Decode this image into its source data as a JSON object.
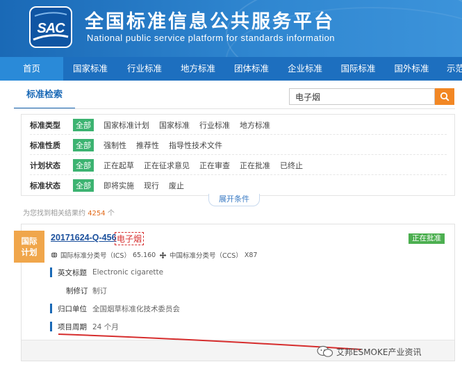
{
  "header": {
    "logo_text": "SAC",
    "title": "全国标准信息公共服务平台",
    "subtitle": "National public service platform  for standards information"
  },
  "nav": {
    "items": [
      {
        "label": "首页"
      },
      {
        "label": "国家标准"
      },
      {
        "label": "行业标准"
      },
      {
        "label": "地方标准"
      },
      {
        "label": "团体标准"
      },
      {
        "label": "企业标准"
      },
      {
        "label": "国际标准"
      },
      {
        "label": "国外标准"
      },
      {
        "label": "示范"
      }
    ]
  },
  "search": {
    "tab_label": "标准检索",
    "query": "电子烟",
    "button_icon": "search-icon"
  },
  "filters": {
    "rows": [
      {
        "label": "标准类型",
        "options": [
          "全部",
          "国家标准计划",
          "国家标准",
          "行业标准",
          "地方标准"
        ]
      },
      {
        "label": "标准性质",
        "options": [
          "全部",
          "强制性",
          "推荐性",
          "指导性技术文件"
        ]
      },
      {
        "label": "计划状态",
        "options": [
          "全部",
          "正在起草",
          "正在征求意见",
          "正在审查",
          "正在批准",
          "已终止"
        ]
      },
      {
        "label": "标准状态",
        "options": [
          "全部",
          "即将实施",
          "现行",
          "废止"
        ]
      }
    ],
    "expand_label": "展开条件"
  },
  "result_count": {
    "prefix": "为您找到相关结果约",
    "count": "4254",
    "suffix": "个"
  },
  "result": {
    "badge_line1": "国际",
    "badge_line2": "计划",
    "doc_id": "20171624-Q-456",
    "keyword": "电子烟",
    "status": "正在批准",
    "ics_label": "国际标准分类号（ICS）",
    "ics_value": "65.160",
    "ccs_label": "中国标准分类号（CCS）",
    "ccs_value": "X87",
    "fields": [
      {
        "key": "英文标题",
        "value": "Electronic cigarette"
      },
      {
        "key": "制修订",
        "value": "制订"
      },
      {
        "key": "归口单位",
        "value": "全国烟草标准化技术委员会"
      },
      {
        "key": "项目周期",
        "value": "24 个月"
      }
    ]
  },
  "watermark": {
    "text": "艾邦ESMOKE产业资讯"
  },
  "colors": {
    "header_blue": "#1a69b6",
    "nav_blue": "#1d6fbf",
    "search_orange": "#f28724",
    "selected_green": "#3cb371",
    "badge_orange": "#f0a64b",
    "status_green": "#4caf50",
    "annotation_red": "#d62d2d"
  }
}
